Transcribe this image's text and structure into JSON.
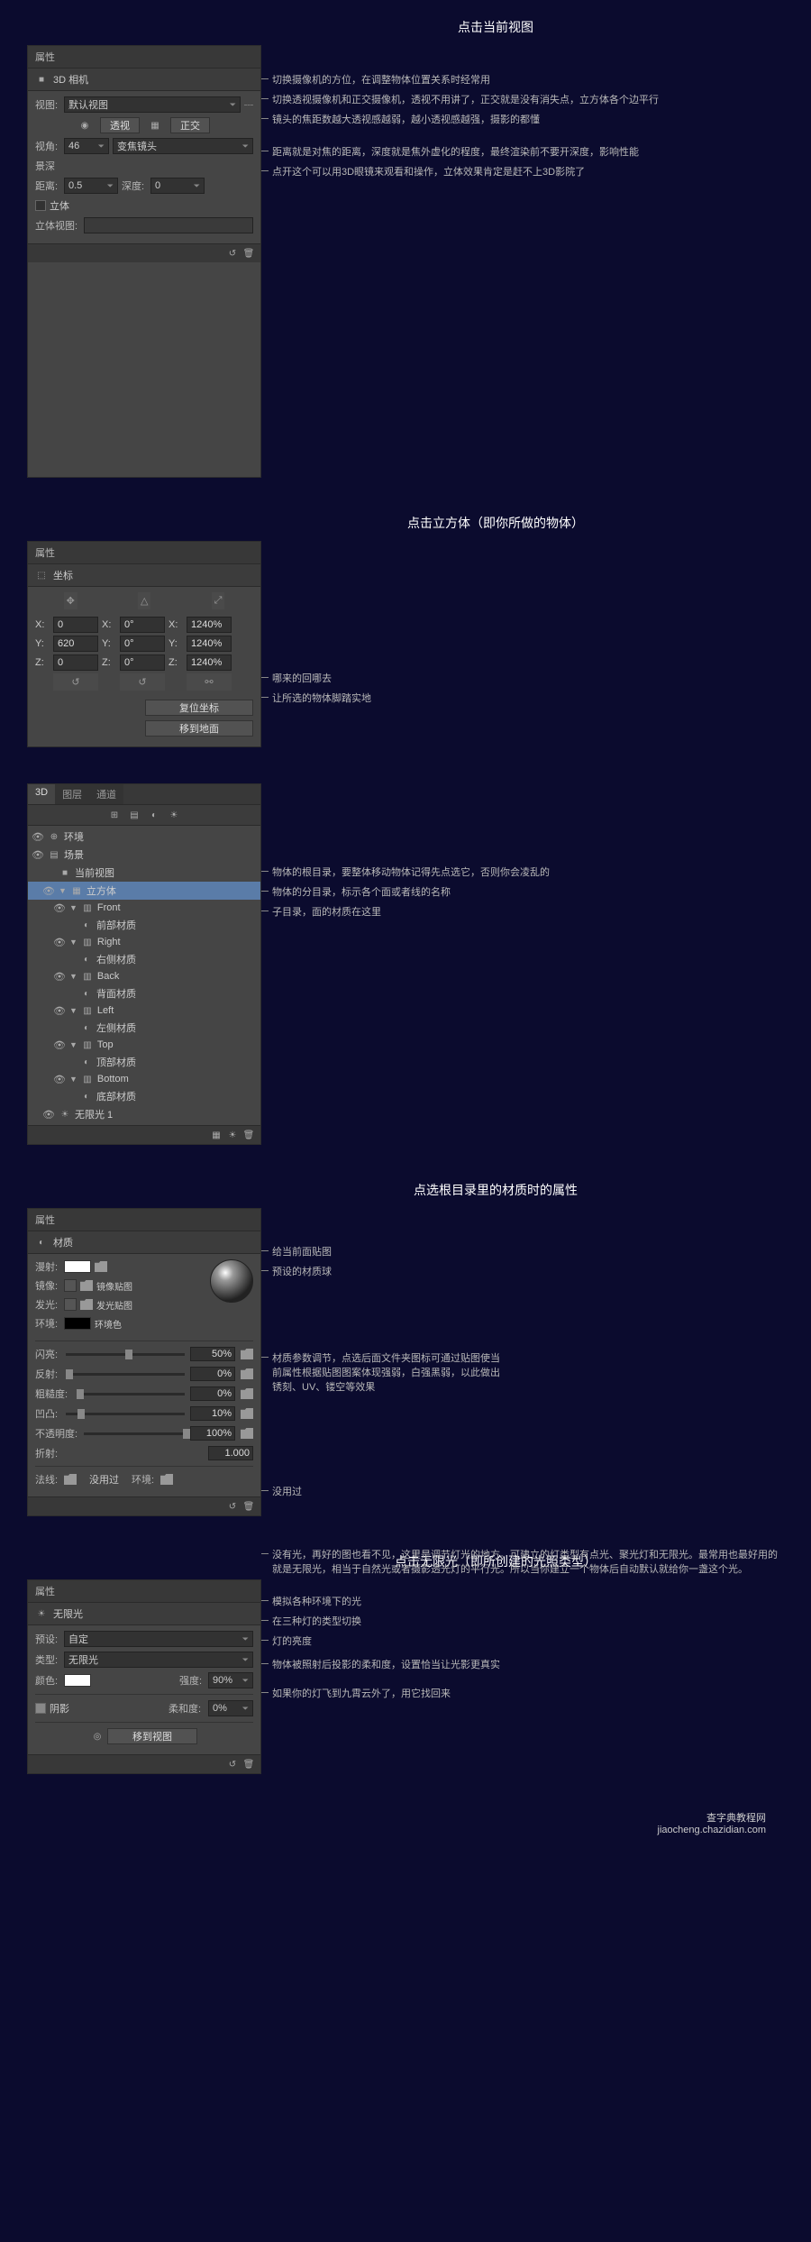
{
  "section1": {
    "title": "点击当前视图",
    "panel_title": "属性",
    "sub_icon": "📷",
    "sub_title": "3D 相机",
    "view_label": "视图:",
    "view_value": "默认视图",
    "persp_btn": "透视",
    "ortho_btn": "正交",
    "fov_label": "视角:",
    "fov_value": "46",
    "lens_value": "变焦镜头",
    "depth_label": "景深",
    "dist_label": "距离:",
    "dist_value": "0.5",
    "depth_field_label": "深度:",
    "depth_value": "0",
    "stereo_label": "立体",
    "stereo_view_label": "立体视图:",
    "annos": [
      "切换摄像机的方位，在调整物体位置关系时经常用",
      "切换透视摄像机和正交摄像机，透视不用讲了，正交就是没有消失点，立方体各个边平行",
      "镜头的焦距数越大透视感越弱，越小透视感越强，摄影的都懂",
      "距离就是对焦的距离，深度就是焦外虚化的程度，最终渲染前不要开深度，影响性能",
      "点开这个可以用3D眼镜来观看和操作，立体效果肯定是赶不上3D影院了"
    ]
  },
  "section2": {
    "title": "点击立方体（即你所做的物体）",
    "panel_title": "属性",
    "sub_title": "坐标",
    "x_label": "X:",
    "y_label": "Y:",
    "z_label": "Z:",
    "x_val": "0",
    "y_val": "620",
    "z_val": "0",
    "rx_label": "X:",
    "ry_label": "Y:",
    "rz_label": "Z:",
    "rx_val": "0°",
    "ry_val": "0°",
    "rz_val": "0°",
    "sx_label": "X:",
    "sy_label": "Y:",
    "sz_label": "Z:",
    "sx_val": "1240%",
    "sy_val": "1240%",
    "sz_val": "1240%",
    "reset_btn": "复位坐标",
    "ground_btn": "移到地面",
    "annos": [
      "哪来的回哪去",
      "让所选的物体脚踏实地"
    ]
  },
  "section3": {
    "tabs": [
      "3D",
      "图层",
      "通道"
    ],
    "items": {
      "env": "环境",
      "scene": "场景",
      "current_view": "当前视图",
      "cube": "立方体",
      "front": "Front",
      "front_mat": "前部材质",
      "right": "Right",
      "right_mat": "右侧材质",
      "back": "Back",
      "back_mat": "背面材质",
      "left": "Left",
      "left_mat": "左侧材质",
      "top": "Top",
      "top_mat": "顶部材质",
      "bottom": "Bottom",
      "bottom_mat": "底部材质",
      "light": "无限光 1"
    },
    "annos": [
      "物体的根目录，要整体移动物体记得先点选它，否则你会凌乱的",
      "物体的分目录，标示各个面或者线的名称",
      "子目录，面的材质在这里"
    ]
  },
  "section4": {
    "title": "点选根目录里的材质时的属性",
    "panel_title": "属性",
    "sub_title": "材质",
    "diffuse": "漫射:",
    "mirror": "镜像:",
    "mirror_map": "镜像贴图",
    "glow": "发光:",
    "glow_map": "发光贴图",
    "env": "环境:",
    "env_color": "环境色",
    "shine": "闪亮:",
    "shine_v": "50%",
    "reflect": "反射:",
    "reflect_v": "0%",
    "rough": "粗糙度:",
    "rough_v": "0%",
    "bump": "凹凸:",
    "bump_v": "10%",
    "opacity": "不透明度:",
    "opacity_v": "100%",
    "refract": "折射:",
    "refract_v": "1.000",
    "normal": "法线:",
    "unused": "没用过",
    "env2": "环境:",
    "annos": [
      "给当前面贴图",
      "预设的材质球",
      "材质参数调节，点选后面文件夹图标可通过贴图使当前属性根据贴图图案体现强弱，白强黑弱，以此做出锈刻、UV、镂空等效果",
      "没用过"
    ]
  },
  "section5": {
    "title": "点击无限光（即所创建的光照类型）",
    "intro": "没有光，再好的图也看不见，这里是调节灯光的地方。可建立的灯类型有点光、聚光灯和无限光。最常用也最好用的就是无限光，相当于自然光或者摄影透光灯的平行光。所以当你建立一个物体后自动默认就给你一盏这个光。",
    "panel_title": "属性",
    "sub_title": "无限光",
    "preset_label": "预设:",
    "preset_value": "自定",
    "type_label": "类型:",
    "type_value": "无限光",
    "color_label": "颜色:",
    "intensity_label": "强度:",
    "intensity_value": "90%",
    "shadow_label": "阴影",
    "softness_label": "柔和度:",
    "softness_value": "0%",
    "move_btn": "移到视图",
    "annos": [
      "模拟各种环境下的光",
      "在三种灯的类型切换",
      "灯的亮度",
      "物体被照射后投影的柔和度，设置恰当让光影更真实",
      "如果你的灯飞到九霄云外了，用它找回来"
    ]
  },
  "watermark": {
    "line1": "查字典教程网",
    "line2": "jiaocheng.chazidian.com"
  }
}
